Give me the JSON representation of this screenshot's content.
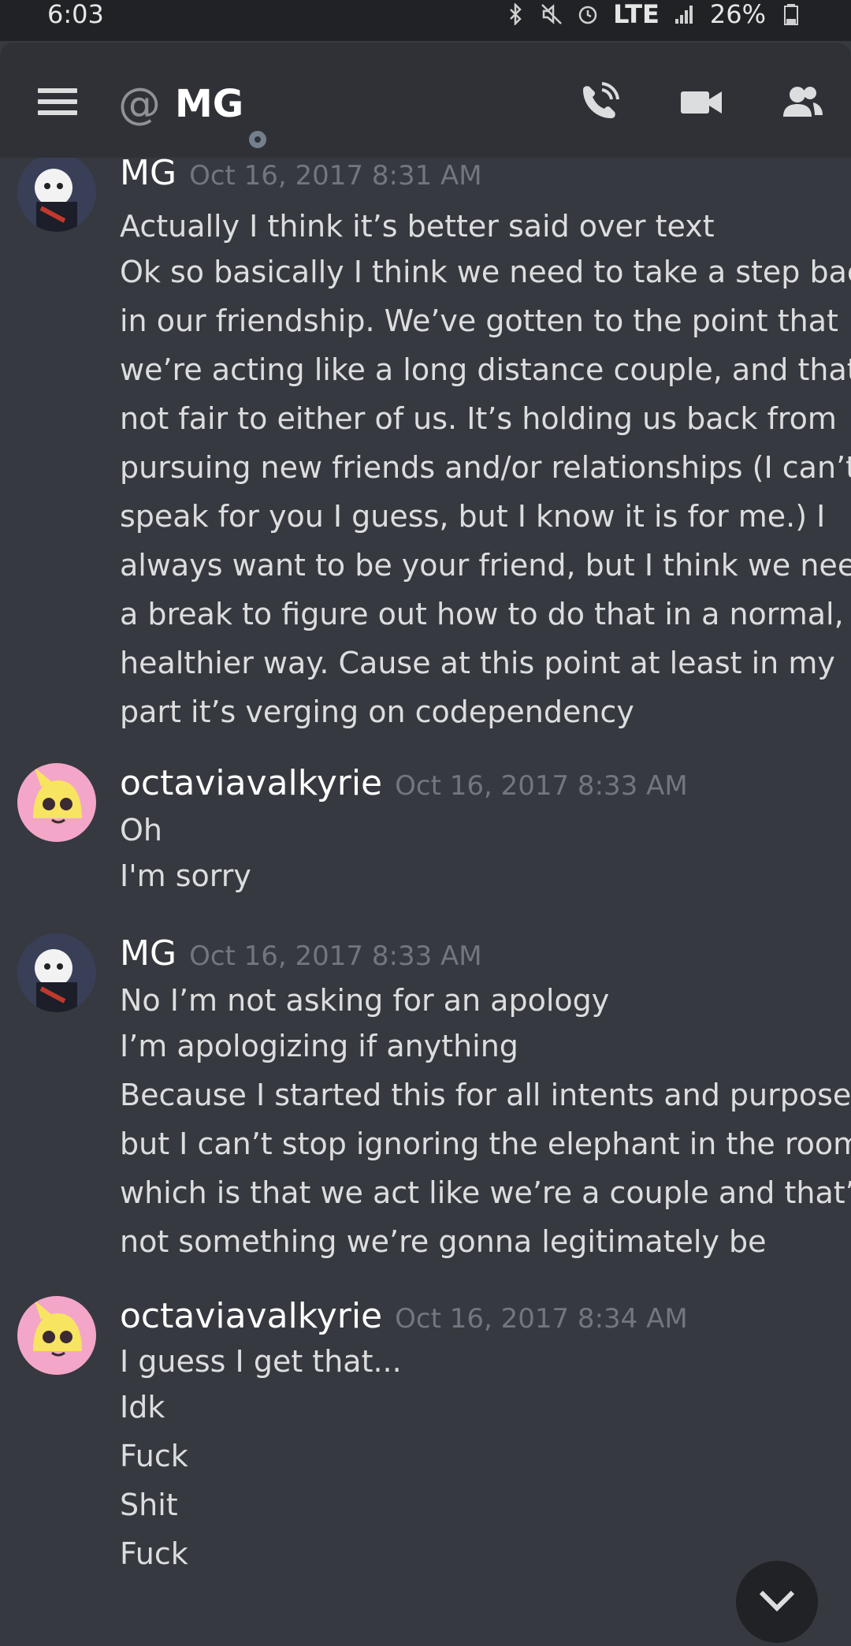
{
  "status_bar": {
    "time": "6:03",
    "network": "LTE",
    "battery": "26%",
    "icons": [
      "bluetooth-icon",
      "mute-icon",
      "alarm-icon",
      "signal-icon",
      "battery-icon"
    ]
  },
  "header": {
    "channel_prefix": "@",
    "channel_name": "MG",
    "status": "offline",
    "actions": [
      "call-icon",
      "video-icon",
      "members-icon"
    ]
  },
  "messages": [
    {
      "author": "MG",
      "timestamp": "Oct 16, 2017 8:31 AM",
      "lines": [
        "Actually I think it’s better said over text",
        "Ok so basically I think we need to take a step back",
        "in our friendship. We’ve gotten to the point that",
        "we’re acting like a long distance couple, and that’s",
        "not fair to either of us. It’s holding us back from",
        "pursuing new friends and/or relationships (I can’t",
        "speak for you I guess, but I know it is for me.) I",
        "always want to be your friend, but I think we need",
        "a break to figure out how to do that in a normal,",
        "healthier way. Cause at this point at least in my",
        "part it’s verging on codependency"
      ]
    },
    {
      "author": "octaviavalkyrie",
      "timestamp": "Oct 16, 2017 8:33 AM",
      "lines": [
        "Oh",
        "I'm sorry"
      ]
    },
    {
      "author": "MG",
      "timestamp": "Oct 16, 2017 8:33 AM",
      "lines": [
        "No I’m not asking for an apology",
        "I’m apologizing if anything",
        "Because I started this for all intents and purposes",
        "but I can’t stop ignoring the elephant in the room,",
        "which is that we act like we’re a couple and that’s",
        "not something we’re gonna legitimately be"
      ]
    },
    {
      "author": "octaviavalkyrie",
      "timestamp": "Oct 16, 2017 8:34 AM",
      "lines": [
        "I guess I get that...",
        "Idk",
        "Fuck",
        "Shit",
        "Fuck"
      ]
    }
  ],
  "colors": {
    "background": "#36393f",
    "header": "#2f3136",
    "status_bar": "#202225",
    "text": "#dcddde",
    "timestamp": "#72767d"
  }
}
